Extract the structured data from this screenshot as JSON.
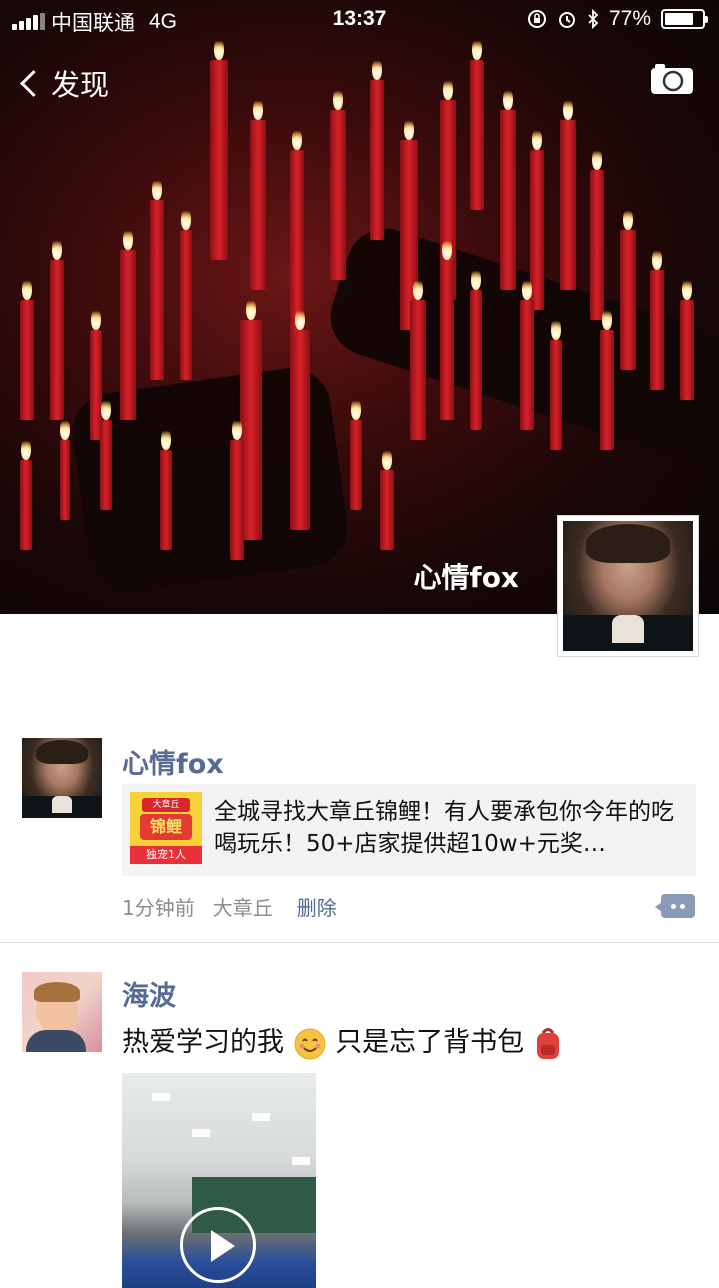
{
  "status_bar": {
    "carrier": "中国联通",
    "network": "4G",
    "time": "13:37",
    "battery": "77%",
    "battery_level": 0.77
  },
  "nav": {
    "back_label": "发现"
  },
  "profile": {
    "nickname": "心情fox"
  },
  "posts": [
    {
      "name": "心情fox",
      "link_title": "全城寻找大章丘锦鲤！有人要承包你今年的吃喝玩乐！50+店家提供超10w+元奖…",
      "link_thumb": {
        "top": "大章丘",
        "middle": "锦鲤",
        "bottom": "独宠1人"
      },
      "time": "1分钟前",
      "location": "大章丘",
      "delete_label": "删除"
    },
    {
      "name": "海波",
      "text_part1": "热爱学习的我",
      "text_part2": " 只是忘了背书包",
      "emoji1": "smiling-face",
      "emoji2": "school-backpack"
    }
  ]
}
